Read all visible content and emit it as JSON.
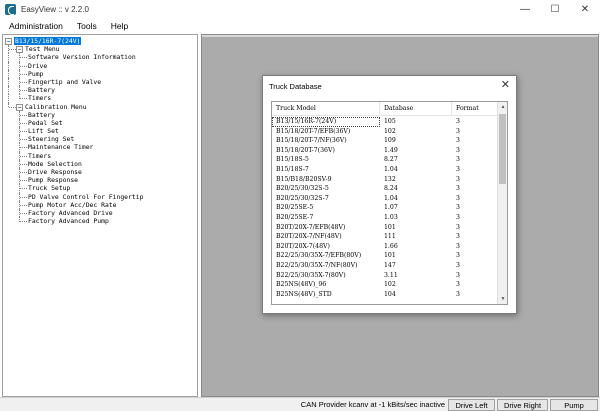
{
  "window": {
    "title": "EasyView :: v 2.2.0",
    "minimize": "—",
    "maximize": "☐",
    "close": "✕"
  },
  "menu": [
    "Administration",
    "Tools",
    "Help"
  ],
  "tree": {
    "root": "B13/15/16R-7(24V)",
    "test_menu": {
      "label": "Test Menu",
      "items": [
        "Software Version Information",
        "Drive",
        "Pump",
        "Fingertip and Valve",
        "Battery",
        "Timers"
      ]
    },
    "calibration_menu": {
      "label": "Calibration Menu",
      "items": [
        "Battery",
        "Pedal Set",
        "Lift Set",
        "Steering Set",
        "Maintenance Timer",
        "Timers",
        "Mode Selection",
        "Drive Response",
        "Pump Response",
        "Truck Setup",
        "PD Valve Control For Fingertip",
        "Pump Motor Acc/Dec Rate",
        "Factory Advanced Drive",
        "Factory Advanced Pump"
      ]
    }
  },
  "dialog": {
    "title": "Truck Database",
    "close": "✕",
    "columns": [
      "Truck Model",
      "Database",
      "Format"
    ],
    "rows": [
      [
        "B13/15/16R-7(24V)",
        "105",
        "3"
      ],
      [
        "B15/18/20T-7/EFB(36V)",
        "102",
        "3"
      ],
      [
        "B15/18/20T-7/NF(36V)",
        "109",
        "3"
      ],
      [
        "B15/18/20T-7(36V)",
        "1.49",
        "3"
      ],
      [
        "B15/18S-5",
        "8.27",
        "3"
      ],
      [
        "B15/18S-7",
        "1.04",
        "3"
      ],
      [
        "B15/B18/B20SV-9",
        "132",
        "3"
      ],
      [
        "B20/25/30/32S-5",
        "8.24",
        "3"
      ],
      [
        "B20/25/30/32S-7",
        "1.04",
        "3"
      ],
      [
        "B20/25SE-5",
        "1.07",
        "3"
      ],
      [
        "B20/25SE-7",
        "1.03",
        "3"
      ],
      [
        "B20T/20X-7/EFB(48V)",
        "101",
        "3"
      ],
      [
        "B20T/20X-7/NF(48V)",
        "111",
        "3"
      ],
      [
        "B20T/20X-7(48V)",
        "1.66",
        "3"
      ],
      [
        "B22/25/30/35X-7/EFB(80V)",
        "101",
        "3"
      ],
      [
        "B22/25/30/35X-7/NF(80V)",
        "147",
        "3"
      ],
      [
        "B22/25/30/35X-7(80V)",
        "3.11",
        "3"
      ],
      [
        "B25NS(48V)_96",
        "102",
        "3"
      ],
      [
        "B25NS(48V)_STD",
        "104",
        "3"
      ]
    ]
  },
  "status": {
    "text": "CAN Provider kcanv at -1 kBits/sec inactive",
    "buttons": [
      "Drive Left",
      "Drive Right",
      "Pump"
    ]
  }
}
